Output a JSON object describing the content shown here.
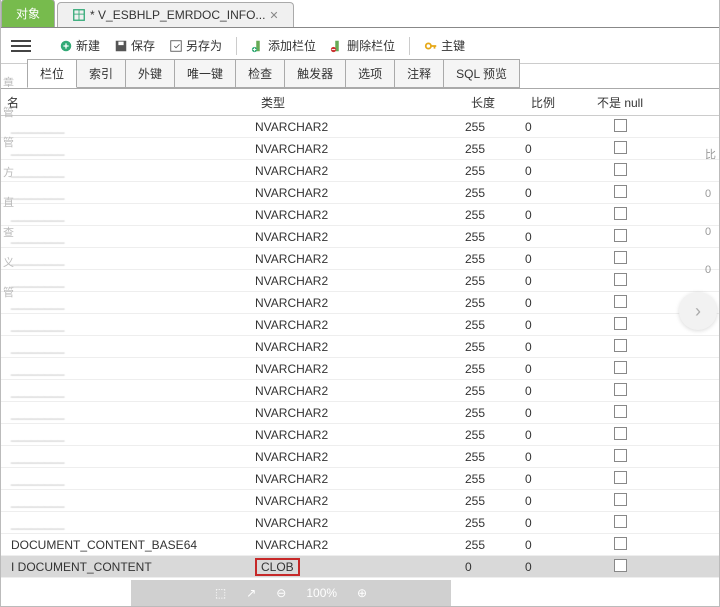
{
  "top_tabs": {
    "object": "对象",
    "file": "* V_ESBHLP_EMRDOC_INFO..."
  },
  "toolbar": {
    "new": "新建",
    "save": "保存",
    "saveas": "另存为",
    "addcol": "添加栏位",
    "delcol": "删除栏位",
    "pk": "主键"
  },
  "sub_tabs": [
    "栏位",
    "索引",
    "外键",
    "唯一键",
    "检查",
    "触发器",
    "选项",
    "注释",
    "SQL 预览"
  ],
  "headers": {
    "name": "名",
    "type": "类型",
    "len": "长度",
    "scale": "比例",
    "notnull": "不是 null"
  },
  "rows": [
    {
      "name": "________",
      "type": "NVARCHAR2",
      "len": "255",
      "scale": "0"
    },
    {
      "name": "________",
      "type": "NVARCHAR2",
      "len": "255",
      "scale": "0"
    },
    {
      "name": "________",
      "type": "NVARCHAR2",
      "len": "255",
      "scale": "0"
    },
    {
      "name": "________",
      "type": "NVARCHAR2",
      "len": "255",
      "scale": "0"
    },
    {
      "name": "________",
      "type": "NVARCHAR2",
      "len": "255",
      "scale": "0"
    },
    {
      "name": "________",
      "type": "NVARCHAR2",
      "len": "255",
      "scale": "0"
    },
    {
      "name": "________",
      "type": "NVARCHAR2",
      "len": "255",
      "scale": "0"
    },
    {
      "name": "________",
      "type": "NVARCHAR2",
      "len": "255",
      "scale": "0"
    },
    {
      "name": "________",
      "type": "NVARCHAR2",
      "len": "255",
      "scale": "0"
    },
    {
      "name": "________",
      "type": "NVARCHAR2",
      "len": "255",
      "scale": "0"
    },
    {
      "name": "________",
      "type": "NVARCHAR2",
      "len": "255",
      "scale": "0"
    },
    {
      "name": "________",
      "type": "NVARCHAR2",
      "len": "255",
      "scale": "0"
    },
    {
      "name": "________",
      "type": "NVARCHAR2",
      "len": "255",
      "scale": "0"
    },
    {
      "name": "________",
      "type": "NVARCHAR2",
      "len": "255",
      "scale": "0"
    },
    {
      "name": "________",
      "type": "NVARCHAR2",
      "len": "255",
      "scale": "0"
    },
    {
      "name": "________",
      "type": "NVARCHAR2",
      "len": "255",
      "scale": "0"
    },
    {
      "name": "________",
      "type": "NVARCHAR2",
      "len": "255",
      "scale": "0"
    },
    {
      "name": "________",
      "type": "NVARCHAR2",
      "len": "255",
      "scale": "0"
    },
    {
      "name": "________",
      "type": "NVARCHAR2",
      "len": "255",
      "scale": "0"
    },
    {
      "name": "DOCUMENT_CONTENT_BASE64",
      "type": "NVARCHAR2",
      "len": "255",
      "scale": "0",
      "clear": true
    },
    {
      "name": "DOCUMENT_CONTENT",
      "type": "CLOB",
      "len": "0",
      "scale": "0",
      "clear": true,
      "selected": true,
      "red": true,
      "marker": "I"
    }
  ],
  "footer": {
    "zoom": "100%"
  },
  "side": [
    "章",
    "管",
    "管",
    "方",
    "直",
    "查",
    "义",
    "管"
  ],
  "right": [
    "比",
    "0",
    "0",
    "0"
  ]
}
